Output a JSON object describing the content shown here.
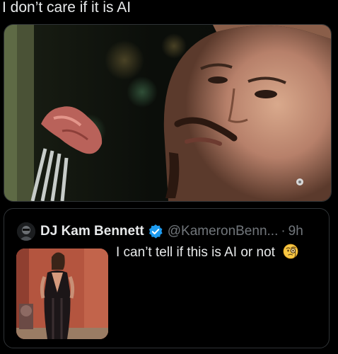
{
  "post": {
    "text": "I don’t care if it is AI",
    "media_icon": "movie-still-image"
  },
  "quote": {
    "display_name": "DJ Kam Bennett",
    "verified_icon": "verified-badge-icon",
    "handle": "@KameronBenn...",
    "separator": "·",
    "timestamp": "9h",
    "text": "I can’t tell if this is AI or not",
    "emoji_icon": "face-with-monocle-icon",
    "thumbnail_icon": "photo-thumbnail"
  },
  "colors": {
    "background": "#000000",
    "text_primary": "#e7e9ea",
    "text_secondary": "#71767b",
    "border": "#2f3336",
    "verified": "#1d9bf0"
  }
}
